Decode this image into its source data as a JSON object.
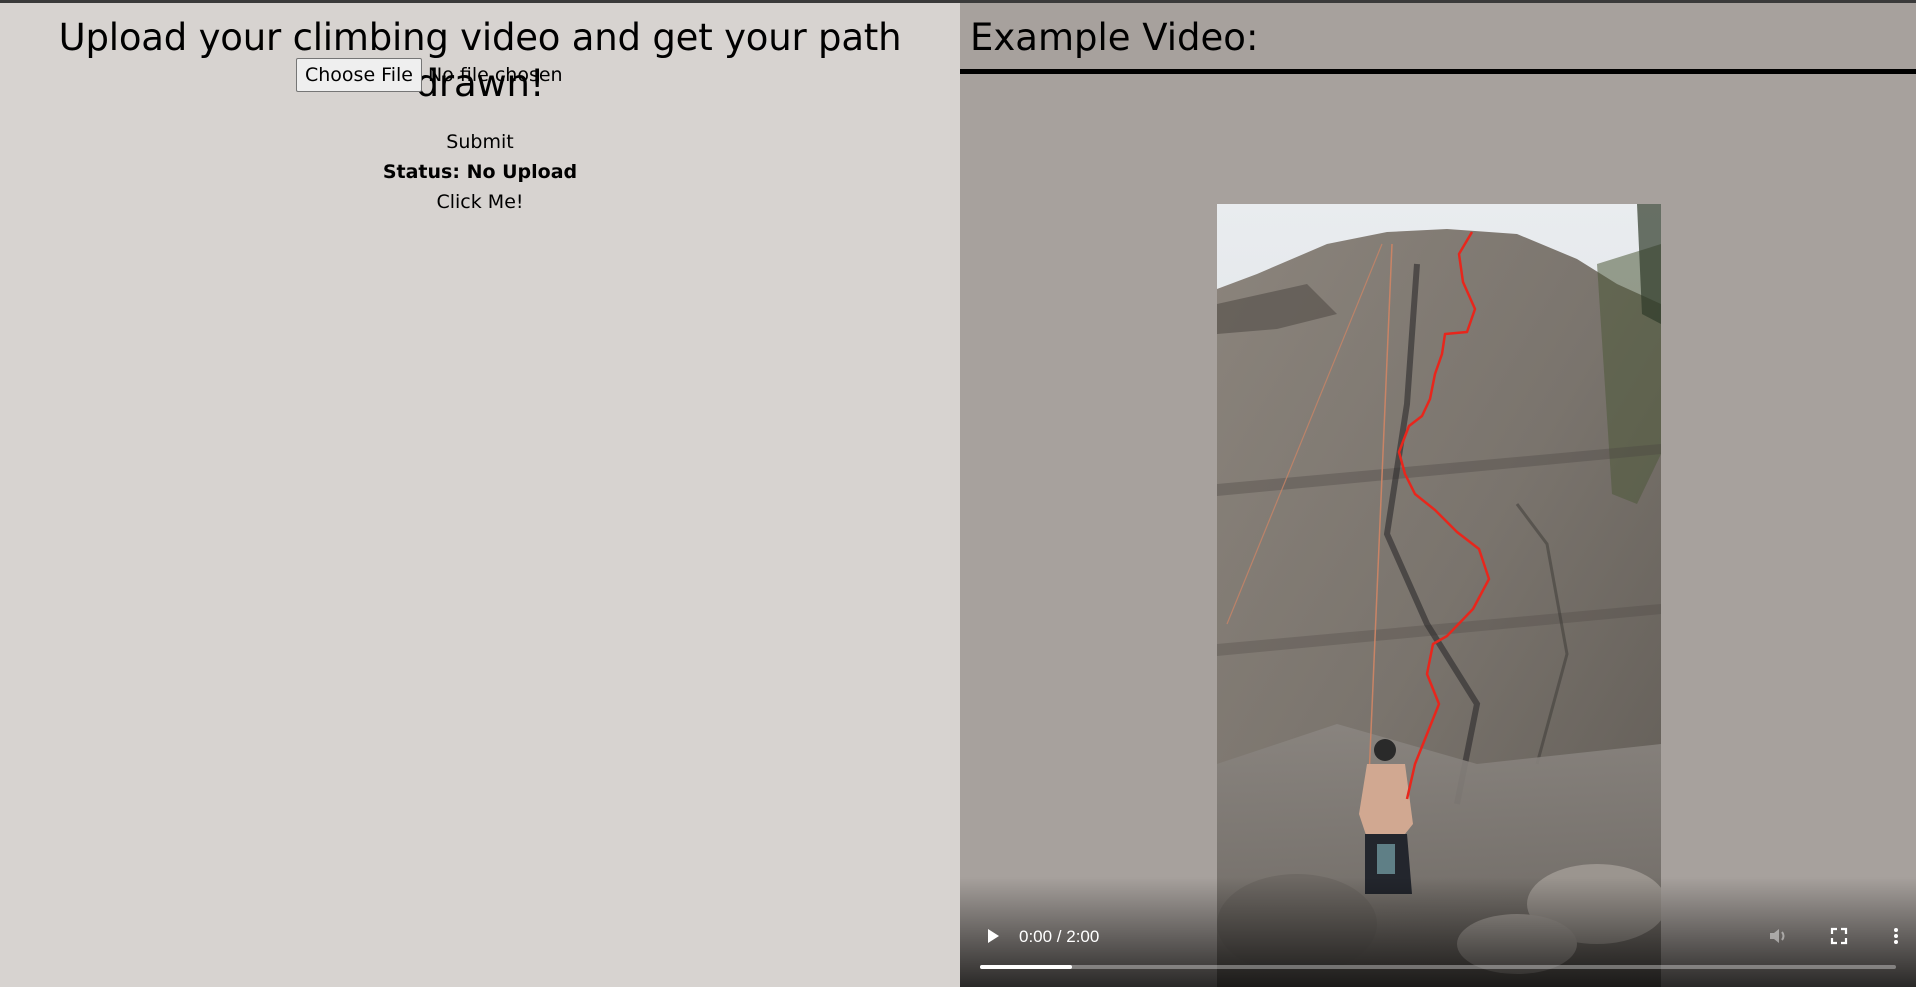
{
  "upload": {
    "heading": "Upload your climbing video and get your path drawn!",
    "choose_file_label": "Choose File",
    "no_file_text": "No file chosen",
    "submit_label": "Submit",
    "status_text": "Status: No Upload",
    "click_me_label": "Click Me!"
  },
  "example": {
    "heading": "Example Video:",
    "video": {
      "time_display": "0:00 / 2:00",
      "progress_fraction": 0.1,
      "controls": [
        "play-icon",
        "volume-icon",
        "fullscreen-icon",
        "more-options-icon"
      ]
    }
  },
  "colors": {
    "left_bg": "#d7d3d0",
    "right_bg": "#a7a19d",
    "path_red": "#e8261c"
  }
}
